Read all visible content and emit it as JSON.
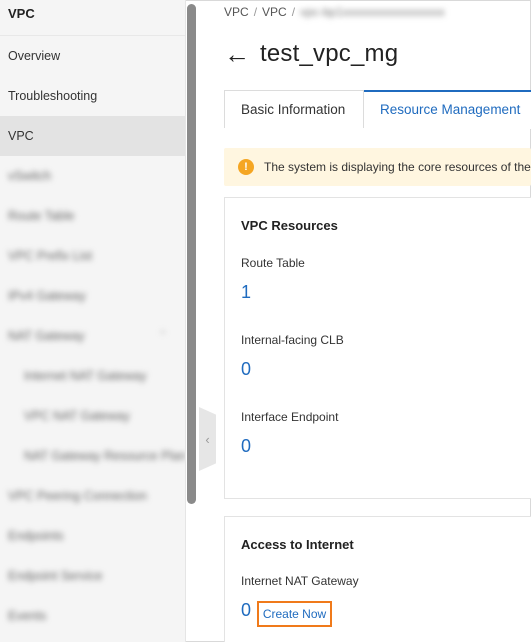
{
  "sidebar": {
    "title": "VPC",
    "items": [
      {
        "label": "Overview",
        "active": false,
        "blurred": false,
        "sub": false
      },
      {
        "label": "Troubleshooting",
        "active": false,
        "blurred": false,
        "sub": false
      },
      {
        "label": "VPC",
        "active": true,
        "blurred": false,
        "sub": false
      },
      {
        "label": "vSwitch",
        "active": false,
        "blurred": true,
        "sub": false
      },
      {
        "label": "Route Table",
        "active": false,
        "blurred": true,
        "sub": false
      },
      {
        "label": "VPC Prefix List",
        "active": false,
        "blurred": true,
        "sub": false
      },
      {
        "label": "IPv4 Gateway",
        "active": false,
        "blurred": true,
        "sub": false
      },
      {
        "label": "NAT Gateway",
        "active": false,
        "blurred": true,
        "sub": false
      },
      {
        "label": "Internet NAT Gateway",
        "active": false,
        "blurred": true,
        "sub": true
      },
      {
        "label": "VPC NAT Gateway",
        "active": false,
        "blurred": true,
        "sub": true
      },
      {
        "label": "NAT Gateway Resource Plan",
        "active": false,
        "blurred": true,
        "sub": true
      },
      {
        "label": "VPC Peering Connection",
        "active": false,
        "blurred": true,
        "sub": false
      },
      {
        "label": "Endpoints",
        "active": false,
        "blurred": true,
        "sub": false
      },
      {
        "label": "Endpoint Service",
        "active": false,
        "blurred": true,
        "sub": false
      },
      {
        "label": "Events",
        "active": false,
        "blurred": true,
        "sub": false
      }
    ]
  },
  "breadcrumb": {
    "items": [
      "VPC",
      "VPC",
      "vpc-bp1xxxxxxxxxxxxxxxxx"
    ]
  },
  "header": {
    "title": "test_vpc_mg"
  },
  "tabs": {
    "basic": "Basic Information",
    "resource": "Resource Management"
  },
  "alert": {
    "text": "The system is displaying the core resources of the"
  },
  "vpc_resources": {
    "title": "VPC Resources",
    "route_table_label": "Route Table",
    "route_table_value": "1",
    "clb_label": "Internal-facing CLB",
    "clb_value": "0",
    "endpoint_label": "Interface Endpoint",
    "endpoint_value": "0"
  },
  "internet_access": {
    "title": "Access to Internet",
    "nat_label": "Internet NAT Gateway",
    "nat_value": "0",
    "create_label": "Create Now"
  },
  "colors": {
    "accent": "#1f6bbf",
    "highlight": "#f07a1a",
    "warning": "#f5a623"
  }
}
